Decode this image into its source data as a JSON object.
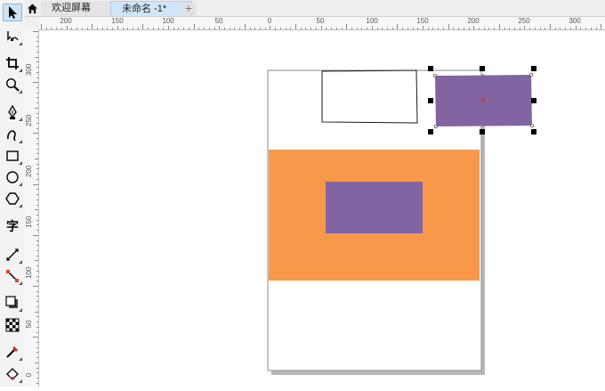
{
  "tabs": [
    {
      "label": "欢迎屏幕"
    },
    {
      "label": "未命名 -1*"
    }
  ],
  "add_tab_label": "+",
  "toolbox": [
    {
      "name": "pick-tool",
      "icon": "arrow-pointer-icon"
    },
    {
      "name": "shape-tool",
      "icon": "shape-node-icon"
    },
    {
      "name": "crop-tool",
      "icon": "crop-icon"
    },
    {
      "name": "zoom-tool",
      "icon": "magnifier-icon"
    },
    {
      "name": "pen-tool",
      "icon": "pen-nib-icon"
    },
    {
      "name": "artistic-media-tool",
      "icon": "brush-curve-icon"
    },
    {
      "name": "rectangle-tool",
      "icon": "rectangle-icon"
    },
    {
      "name": "ellipse-tool",
      "icon": "ellipse-icon"
    },
    {
      "name": "polygon-tool",
      "icon": "polygon-icon"
    },
    {
      "name": "text-tool",
      "icon": "text-icon",
      "label": "字"
    },
    {
      "name": "dimension-tool",
      "icon": "dimension-line-icon"
    },
    {
      "name": "connector-tool",
      "icon": "connector-icon"
    },
    {
      "name": "drop-shadow-tool",
      "icon": "drop-shadow-icon"
    },
    {
      "name": "transparency-tool",
      "icon": "checker-icon"
    },
    {
      "name": "eyedropper-tool",
      "icon": "eyedropper-icon"
    },
    {
      "name": "fill-tool",
      "icon": "paint-bucket-icon"
    }
  ],
  "horizontal_ruler": {
    "labels": [
      "200",
      "150",
      "100",
      "50",
      "0",
      "50",
      "100",
      "150",
      "200",
      "250",
      "300"
    ]
  },
  "vertical_ruler": {
    "labels": [
      "300",
      "250",
      "200",
      "150",
      "100",
      "50",
      "0"
    ]
  },
  "colors": {
    "orange": "#f7984a",
    "purple": "#8264a2",
    "selection": "#000000",
    "page_shadow": "#b0b0b0"
  }
}
